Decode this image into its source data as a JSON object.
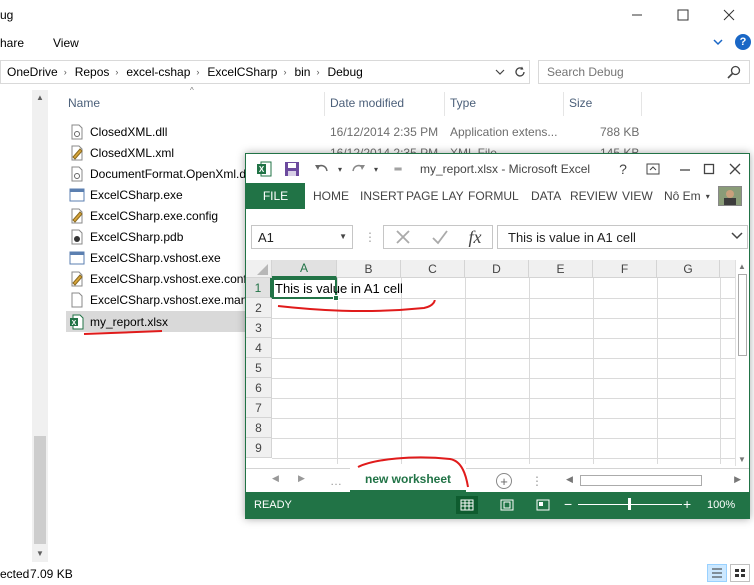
{
  "explorer": {
    "title_partial": "ug",
    "ribbon_tabs": [
      "hare",
      "View"
    ],
    "breadcrumbs": [
      "OneDrive",
      "Repos",
      "excel-cshap",
      "ExcelCSharp",
      "bin",
      "Debug"
    ],
    "search_placeholder": "Search Debug",
    "columns": {
      "name": "Name",
      "date": "Date modified",
      "type": "Type",
      "size": "Size"
    },
    "files": [
      {
        "name": "ClosedXML.dll",
        "date": "16/12/2014 2:35 PM",
        "type": "Application extens...",
        "size": "788 KB",
        "icon": "dll-file-icon"
      },
      {
        "name": "ClosedXML.xml",
        "date": "16/12/2014 2:35 PM",
        "type": "XML File",
        "size": "145 KB",
        "icon": "xml-file-icon"
      },
      {
        "name": "DocumentFormat.OpenXml.d",
        "date": "",
        "type": "",
        "size": "",
        "icon": "dll-file-icon"
      },
      {
        "name": "ExcelCSharp.exe",
        "date": "",
        "type": "",
        "size": "",
        "icon": "exe-file-icon"
      },
      {
        "name": "ExcelCSharp.exe.config",
        "date": "",
        "type": "",
        "size": "",
        "icon": "config-file-icon"
      },
      {
        "name": "ExcelCSharp.pdb",
        "date": "",
        "type": "",
        "size": "",
        "icon": "pdb-file-icon"
      },
      {
        "name": "ExcelCSharp.vshost.exe",
        "date": "",
        "type": "",
        "size": "",
        "icon": "exe-file-icon"
      },
      {
        "name": "ExcelCSharp.vshost.exe.config",
        "date": "",
        "type": "",
        "size": "",
        "icon": "config-file-icon"
      },
      {
        "name": "ExcelCSharp.vshost.exe.manif",
        "date": "",
        "type": "",
        "size": "",
        "icon": "manifest-file-icon"
      },
      {
        "name": "my_report.xlsx",
        "date": "",
        "type": "",
        "size": "",
        "icon": "excel-file-icon"
      }
    ],
    "status_left": "ected",
    "status_size": "7.09 KB"
  },
  "excel": {
    "caption": "my_report.xlsx - Microsoft Excel",
    "help": "?",
    "file_tab": "FILE",
    "tabs": [
      "HOME",
      "INSERT",
      "PAGE LAY",
      "FORMUL",
      "DATA",
      "REVIEW",
      "VIEW"
    ],
    "user_name": "Nô Em",
    "name_box": "A1",
    "formula": "This is value in A1 cell",
    "columns": [
      "A",
      "B",
      "C",
      "D",
      "E",
      "F",
      "G"
    ],
    "rows": [
      "1",
      "2",
      "3",
      "4",
      "5",
      "6",
      "7",
      "8",
      "9"
    ],
    "cell_a1": "This is value in A1 cell",
    "sheet_tab": "new worksheet",
    "status": "READY",
    "zoom_percent": "100%",
    "accent_color": "#217346"
  }
}
